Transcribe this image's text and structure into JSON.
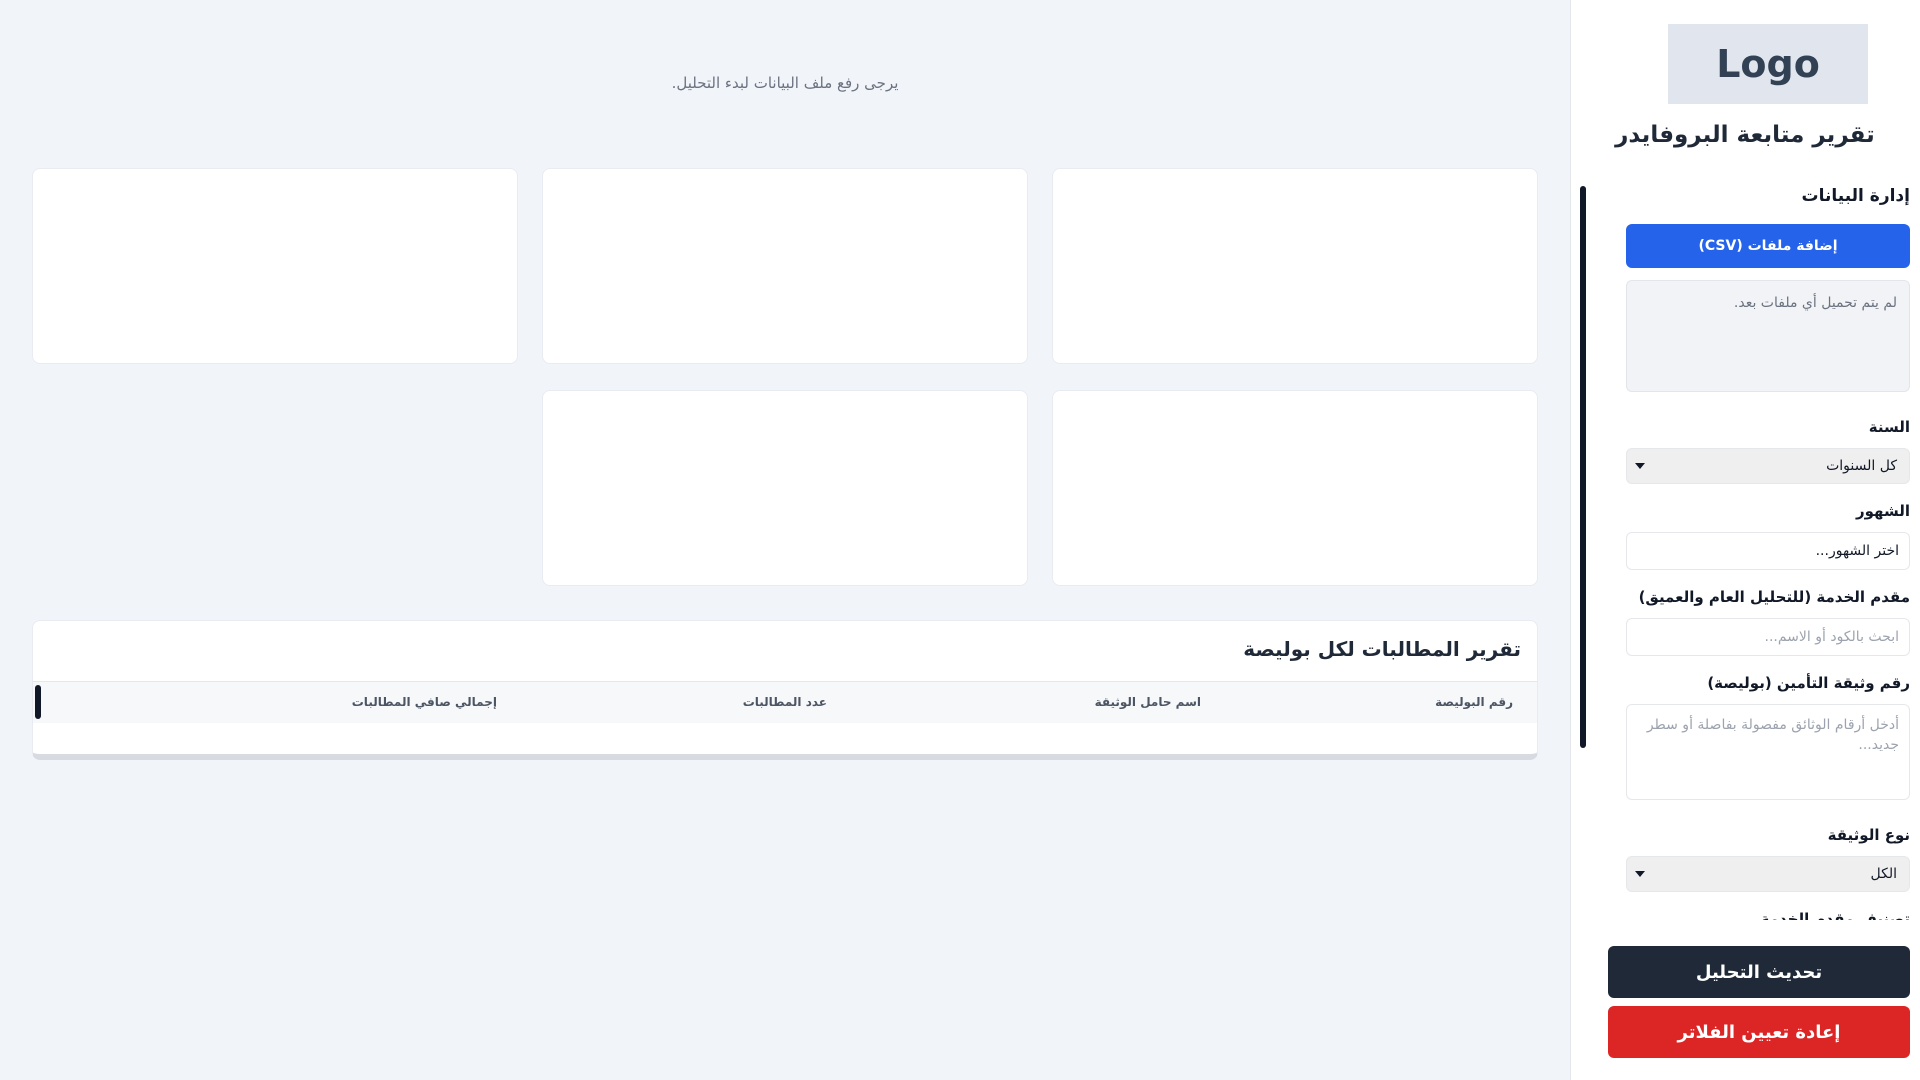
{
  "sidebar": {
    "logo": "Logo",
    "title": "تقرير متابعة البروفايدر",
    "data_section": {
      "heading": "إدارة البيانات",
      "upload_button": "إضافة ملفات (CSV)",
      "files_status": "لم يتم تحميل أي ملفات بعد."
    },
    "year": {
      "label": "السنة",
      "value": "كل السنوات"
    },
    "months": {
      "label": "الشهور",
      "value": "اختر الشهور..."
    },
    "provider": {
      "label": "مقدم الخدمة (للتحليل العام والعميق)",
      "placeholder": "ابحث بالكود أو الاسم..."
    },
    "policy_number": {
      "label": "رقم وثيقة التأمين (بوليصة)",
      "placeholder": "أدخل أرقام الوثائق مفصولة بفاصلة أو سطر جديد..."
    },
    "document_type": {
      "label": "نوع الوثيقة",
      "value": "الكل"
    },
    "provider_class": {
      "label": "تصنيف مقدم الخدمة"
    },
    "update_button": "تحديث التحليل",
    "reset_button": "إعادة تعيين الفلاتر"
  },
  "main": {
    "status_message": "يرجى رفع ملف البيانات لبدء التحليل.",
    "report": {
      "title": "تقرير المطالبات لكل بوليصة",
      "columns": [
        "رقم البوليصة",
        "اسم حامل الوثيقة",
        "عدد المطالبات",
        "إجمالي صافي المطالبات"
      ]
    }
  }
}
